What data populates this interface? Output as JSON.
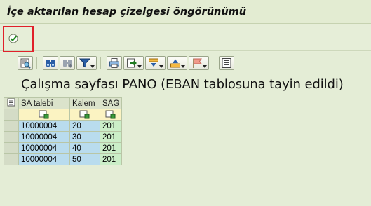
{
  "window": {
    "title": "İçe aktarılan hesap çizelgesi öngörünümü"
  },
  "appbar": {
    "execute_icon": "execute-check-icon"
  },
  "alv_toolbar": {
    "icons": [
      "details-icon",
      "find-icon",
      "find-next-icon",
      "filter-icon",
      "print-icon",
      "export-icon",
      "sum-icon",
      "sort-icon",
      "flag-icon",
      "layout-icon"
    ]
  },
  "alv_title": "Çalışma sayfası PANO (EBAN tablosuna tayin edildi)",
  "table": {
    "columns": [
      "SA talebi",
      "Kalem",
      "SAG"
    ],
    "rows": [
      [
        "10000004",
        "20",
        "201"
      ],
      [
        "10000004",
        "30",
        "201"
      ],
      [
        "10000004",
        "40",
        "201"
      ],
      [
        "10000004",
        "50",
        "201"
      ]
    ]
  },
  "colors": {
    "highlight": "#e0202a",
    "background": "#e6eed8",
    "key_cell": "#b9dcee",
    "value_cell": "#cbeec8"
  }
}
